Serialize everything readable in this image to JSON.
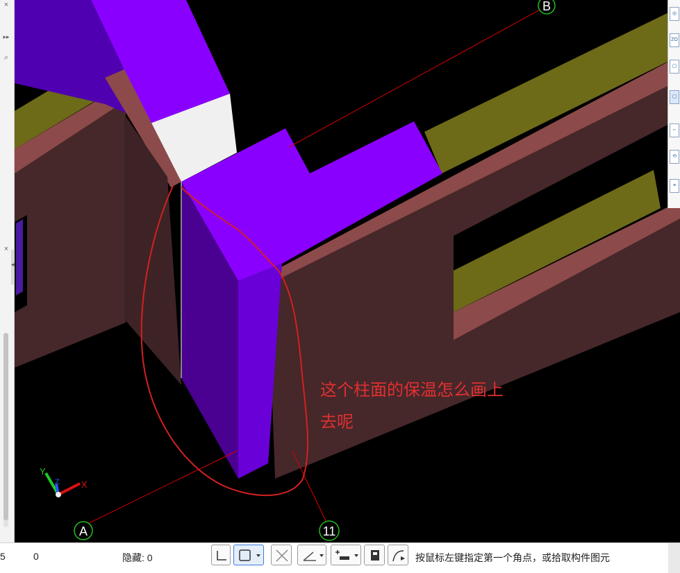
{
  "left_panel": {
    "buttons": [
      "×",
      "▸▸",
      "⌕",
      "×",
      "◂"
    ]
  },
  "viewport": {
    "axis_labels": {
      "a": "A",
      "b": "B",
      "eleven": "11"
    },
    "triad": {
      "x": "X",
      "y": "Y",
      "z": "Z"
    },
    "annotation_line1": "这个柱面的保温怎么画上",
    "annotation_line2": "去呢"
  },
  "right_toolbar": {
    "icons": [
      "orbit-icon",
      "zoom-icon",
      "box-view-icon",
      "box-view-2-icon",
      "corner-icon",
      "rotate-icon",
      "list-icon"
    ],
    "zoom_label": "ZO"
  },
  "status_bar": {
    "cut_value": "5",
    "count_value": "0",
    "hidden_label": "隐藏: 0",
    "message": "按鼠标左键指定第一个角点，或拾取构件图元"
  },
  "colors": {
    "beam_purple": "#8a00ff",
    "column_dark": "#4a0090",
    "wall_brown": "#46272a",
    "slab_olive": "#6d6b17",
    "top_pink": "#8d4a4a",
    "grid_red": "#d60000",
    "annotation_red": "#e03030"
  }
}
